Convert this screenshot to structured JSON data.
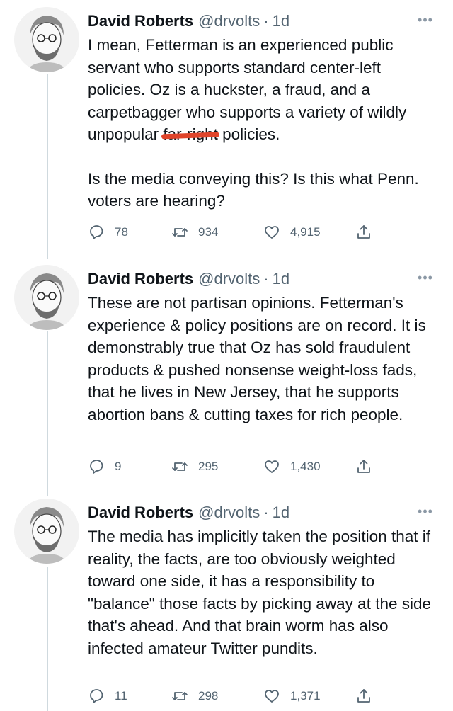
{
  "author": {
    "name": "David Roberts",
    "handle": "@drvolts",
    "separator": "·"
  },
  "more_glyph": "•••",
  "tweets": [
    {
      "time": "1d",
      "body": {
        "p1_before": "I mean, Fetterman is an experienced public servant who supports standard center-left policies. Oz is a huckster, a fraud, and a carpetbagger who supports a variety of wildly unpopular ",
        "p1_struck": "far-right",
        "p1_after": " policies.",
        "p2": "Is the media conveying this? Is this what Penn. voters are hearing?"
      },
      "stats": {
        "replies": "78",
        "retweets": "934",
        "likes": "4,915"
      }
    },
    {
      "time": "1d",
      "body": {
        "p1": "These are not partisan opinions. Fetterman's experience & policy positions are on record. It is demonstrably true that Oz has sold fraudulent products & pushed nonsense weight-loss fads, that he lives in New Jersey, that he supports abortion bans & cutting taxes for rich people."
      },
      "stats": {
        "replies": "9",
        "retweets": "295",
        "likes": "1,430"
      }
    },
    {
      "time": "1d",
      "body": {
        "p1": "The media has implicitly taken the position that if reality, the facts, are too obviously weighted toward one side, it has a responsibility to \"balance\" those facts by picking away at the side that's ahead. And that brain worm has also infected amateur Twitter pundits."
      },
      "stats": {
        "replies": "11",
        "retweets": "298",
        "likes": "1,371"
      }
    }
  ],
  "icons": {
    "reply": "reply-icon",
    "retweet": "retweet-icon",
    "like": "like-icon",
    "share": "share-icon",
    "more": "more-icon"
  },
  "colors": {
    "text": "#0f1419",
    "secondary": "#536471",
    "thread_line": "#cfd9de",
    "strike_mark": "#e0442a"
  }
}
